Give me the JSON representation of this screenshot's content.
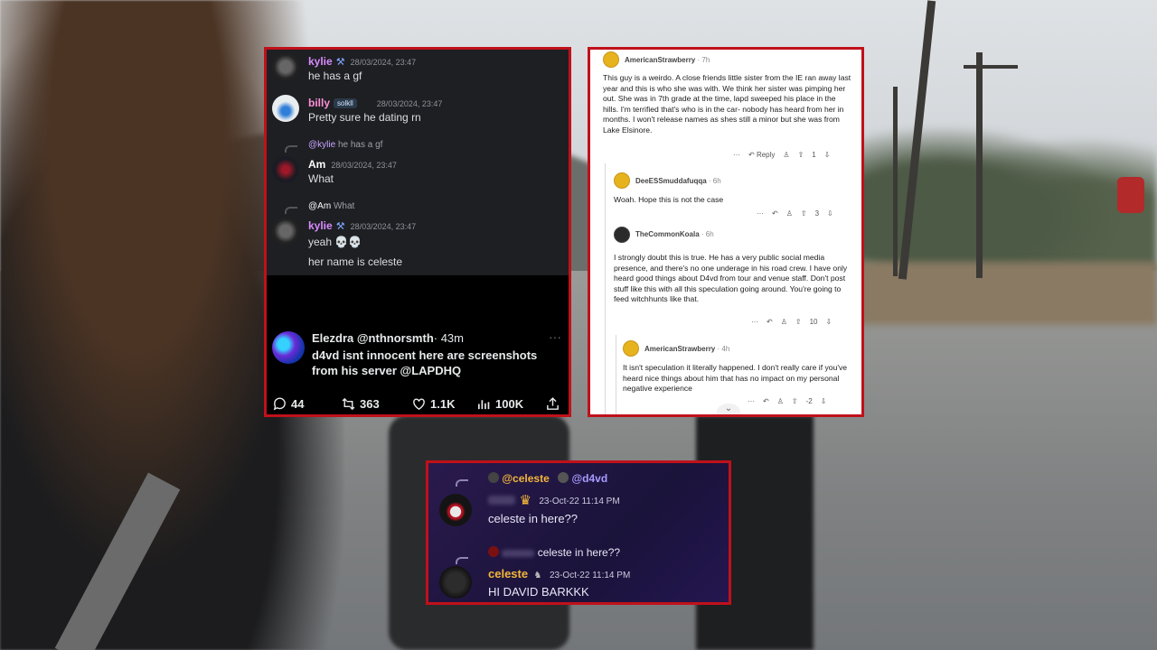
{
  "discord": {
    "messages": [
      {
        "user": "kylie",
        "time": "28/03/2024, 23:47",
        "text": "he has a gf"
      },
      {
        "user": "billy",
        "role": "solkll",
        "time": "28/03/2024, 23:47",
        "text": "Pretty sure he dating rn"
      },
      {
        "reply_to": "@kylie",
        "reply_text": "he has a gf",
        "user": "Am",
        "time": "28/03/2024, 23:47",
        "text": "What"
      },
      {
        "reply_to": "@Am",
        "reply_text": "What",
        "user": "kylie",
        "time": "28/03/2024, 23:47",
        "text": "yeah 💀💀",
        "text2": "her name is celeste"
      }
    ]
  },
  "tweet": {
    "name": "Elezdra",
    "handle": "@nthnorsmth",
    "age": "· 43m",
    "text": "d4vd isnt innocent here are screenshots from his server @LAPDHQ",
    "replies": "44",
    "retweets": "363",
    "likes": "1.1K",
    "views": "100K",
    "more": "···"
  },
  "reddit": {
    "comments": [
      {
        "user": "AmericanStrawberry",
        "time": "· 7h",
        "text": "This guy is a weirdo. A close friends little sister from the IE ran away last year and this is who she was with. We think her sister was pimping her out. She was in 7th grade at the time, lapd sweeped his place in the hills. I'm terrified that's who is in the car- nobody has heard from her in months. I won't release names as shes still a minor but she was from Lake Elsinore.",
        "votes": "1",
        "reply": "Reply"
      },
      {
        "user": "DeeESSmuddafuqqa",
        "time": "· 6h",
        "text": "Woah. Hope this is not the case",
        "votes": "3"
      },
      {
        "user": "TheCommonKoala",
        "time": "· 6h",
        "text": "I strongly doubt this is true. He has a very public social media presence, and there's no one underage in his road crew. I have only heard good things about D4vd from tour and venue staff. Don't post stuff like this with all this speculation going around. You're going to feed witchhunts like that.",
        "votes": "10"
      },
      {
        "user": "AmericanStrawberry",
        "time": "· 4h",
        "text": "It isn't speculation it literally happened. I don't really care if you've heard nice things about him that has no impact on my personal negative experience",
        "votes": "-2"
      }
    ],
    "more": "···"
  },
  "discord2": {
    "reply1_user1": "@celeste",
    "reply1_user2": "@d4vd",
    "msg1_time": "23-Oct-22 11:14 PM",
    "msg1_text": "celeste in here??",
    "reply2_text": "celeste in here??",
    "msg2_user": "celeste",
    "msg2_time": "23-Oct-22 11:14 PM",
    "msg2_text": "HI DAVID BARKKK"
  },
  "colors": {
    "panel_border": "#c0111a",
    "kylie": "#d98bff",
    "billy": "#ff8fd6",
    "celeste": "#f3b63a",
    "d4vd": "#a89bff"
  }
}
